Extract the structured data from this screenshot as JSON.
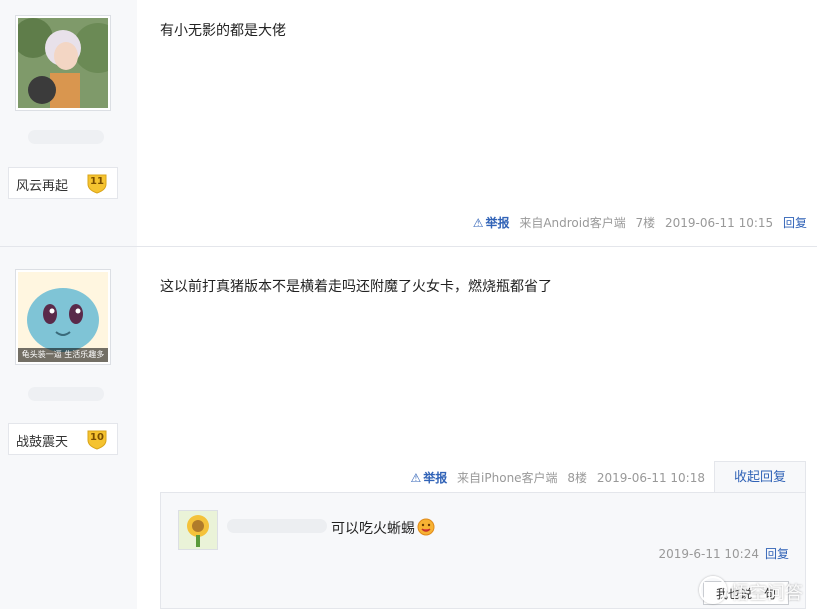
{
  "posts": [
    {
      "avatar": "anime-boy-avatar-icon",
      "level_name": "风云再起",
      "level_num": "11",
      "content": "有小无影的都是大佬",
      "meta": {
        "report": "举报",
        "client": "来自Android客户端",
        "floor": "7楼",
        "time": "2019-06-11 10:15",
        "reply": "回复"
      }
    },
    {
      "avatar": "squirtle-avatar-icon",
      "avatar_caption": "龟头装一逼 生活乐趣多",
      "level_name": "战鼓震天",
      "level_num": "10",
      "content": "这以前打真猪版本不是横着走吗还附魔了火女卡，燃烧瓶都省了",
      "meta": {
        "report": "举报",
        "client": "来自iPhone客户端",
        "floor": "8楼",
        "time": "2019-06-11 10:18",
        "collapse": "收起回复"
      },
      "sub_reply": {
        "text": "可以吃火蜥蜴",
        "time": "2019-6-11 10:24",
        "reply": "回复",
        "say_button": "我也说一句"
      }
    }
  ],
  "watermark": "悟空问答",
  "colors": {
    "link": "#3163b7",
    "sidebar_bg": "#f7f8fa",
    "badge": "#f5c330"
  }
}
